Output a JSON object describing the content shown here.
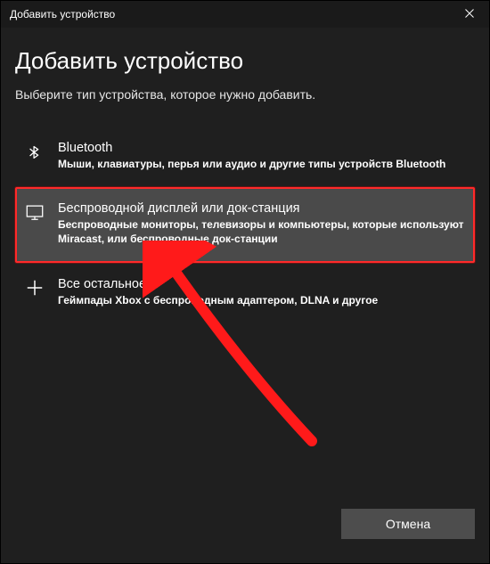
{
  "titlebar": {
    "title": "Добавить устройство"
  },
  "heading": "Добавить устройство",
  "subheading": "Выберите тип устройства, которое нужно добавить.",
  "options": [
    {
      "icon": "bluetooth-icon",
      "title": "Bluetooth",
      "desc": "Мыши, клавиатуры, перья или аудио и другие типы устройств Bluetooth"
    },
    {
      "icon": "monitor-icon",
      "title": "Беспроводной дисплей или док-станция",
      "desc": "Беспроводные мониторы, телевизоры и компьютеры, которые используют Miracast, или беспроводные док-станции"
    },
    {
      "icon": "plus-icon",
      "title": "Все остальное",
      "desc": "Геймпады Xbox с беспроводным адаптером, DLNA и другое"
    }
  ],
  "footer": {
    "cancel_label": "Отмена"
  },
  "annotation": {
    "highlight_color": "#ff2a2a"
  }
}
